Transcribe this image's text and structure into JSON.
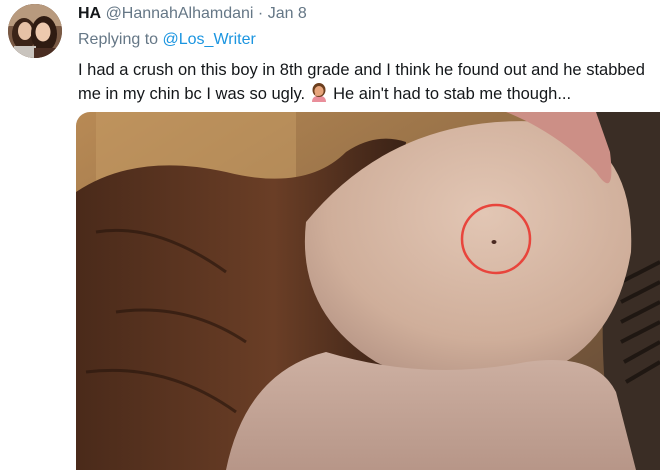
{
  "tweet": {
    "name": "HA",
    "handle": "@HannahAlhamdani",
    "separator": "·",
    "date": "Jan 8",
    "replying_prefix": "Replying to",
    "replying_to": "@Los_Writer",
    "text_line1": "I had a crush on this boy in 8th grade and I think he found out and he stabbed",
    "text_line2a": "me in my chin bc I was so ugly.",
    "text_line2b": "He ain't had to stab me though..."
  },
  "icons": {
    "avatar": "profile-photo",
    "emoji": "person-facepalming-emoji"
  },
  "colors": {
    "link": "#1b95e0",
    "secondary_text": "#657786",
    "annotation_circle": "#e8453c"
  }
}
